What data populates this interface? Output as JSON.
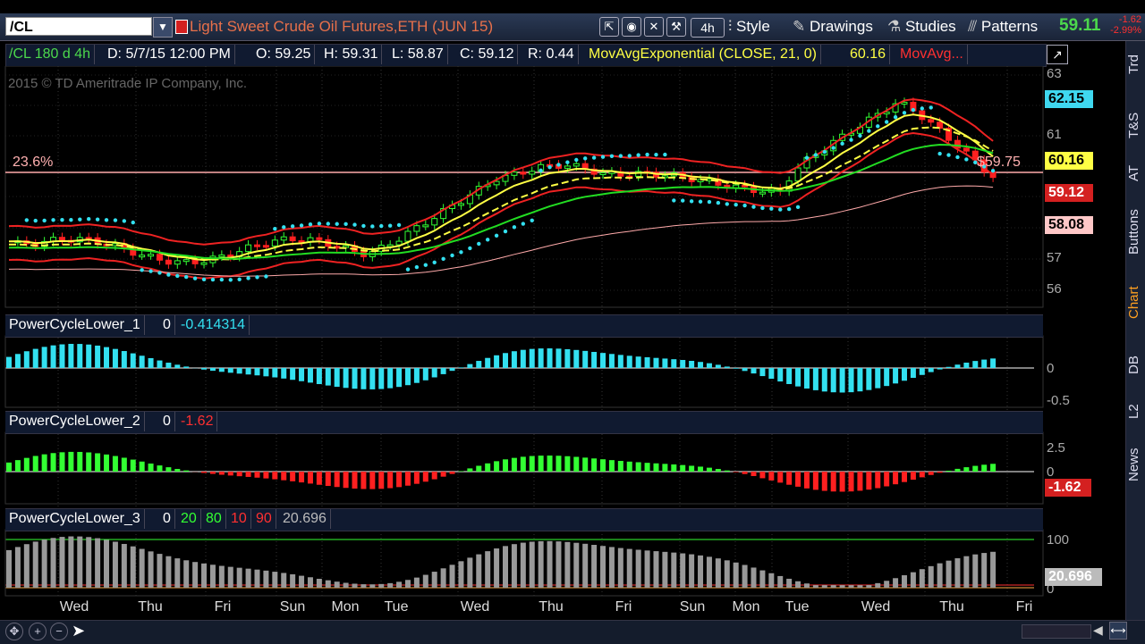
{
  "toolbar": {
    "symbol": "/CL",
    "title": "Light Sweet Crude Oil Futures,ETH (JUN 15)",
    "aggregation": "4h",
    "style_label": "Style",
    "drawings_label": "Drawings",
    "studies_label": "Studies",
    "patterns_label": "Patterns",
    "last_price": "59.11",
    "net_change": "-1.62",
    "pct_change": "-2.99%"
  },
  "infobar": {
    "symbol_period": "/CL 180 d 4h",
    "date": "D: 5/7/15 12:00 PM",
    "open": "O: 59.25",
    "high": "H: 59.31",
    "low": "L: 58.87",
    "close": "C: 59.12",
    "range": "R: 0.44",
    "study1": "MovAvgExponential (CLOSE, 21, 0)",
    "study1_value": "60.16",
    "study2": "MovAvg..."
  },
  "main": {
    "copyright": "2015 © TD Ameritrade IP Company, Inc.",
    "fib_label": "23.6%",
    "fib_price": "$59.75",
    "price_ticks": [
      "63",
      "62",
      "61",
      "60",
      "59",
      "58",
      "57",
      "56"
    ],
    "tags": [
      {
        "text": "62.15",
        "color": "#3fd8f0",
        "fg": "#000"
      },
      {
        "text": "60.16",
        "color": "#ffff44",
        "fg": "#000"
      },
      {
        "text": "59.12",
        "color": "#d42020",
        "fg": "#fff"
      },
      {
        "text": "58.08",
        "color": "#ffc8c8",
        "fg": "#000"
      }
    ]
  },
  "pane1": {
    "name": "PowerCycleLower_1",
    "p0": "0",
    "value": "-0.414314",
    "ticks": [
      "0",
      "-0.5"
    ]
  },
  "pane2": {
    "name": "PowerCycleLower_2",
    "p0": "0",
    "value": "-1.62",
    "ticks": [
      "2.5",
      "0"
    ]
  },
  "pane3": {
    "name": "PowerCycleLower_3",
    "p0": "0",
    "p1": "20",
    "p2": "80",
    "p3": "10",
    "p4": "90",
    "value": "20.696",
    "ticks": [
      "100",
      "0"
    ]
  },
  "xaxis": [
    "Wed",
    "Thu",
    "Fri",
    "Sun",
    "Mon",
    "Tue",
    "Wed",
    "Thu",
    "Fri",
    "Sun",
    "Mon",
    "Tue",
    "Wed",
    "Thu",
    "Fri"
  ],
  "rightbar": [
    "Trd",
    "T&S",
    "AT",
    "Buttons",
    "Chart",
    "DB",
    "L2",
    "News"
  ],
  "colors": {
    "up": "#33ff33",
    "down": "#ff2020",
    "cyan": "#33e0f0",
    "yellow": "#ffff44",
    "green": "#22dd22",
    "red": "#ee2222",
    "pink": "#ffaaaa",
    "gray": "#999999"
  }
}
